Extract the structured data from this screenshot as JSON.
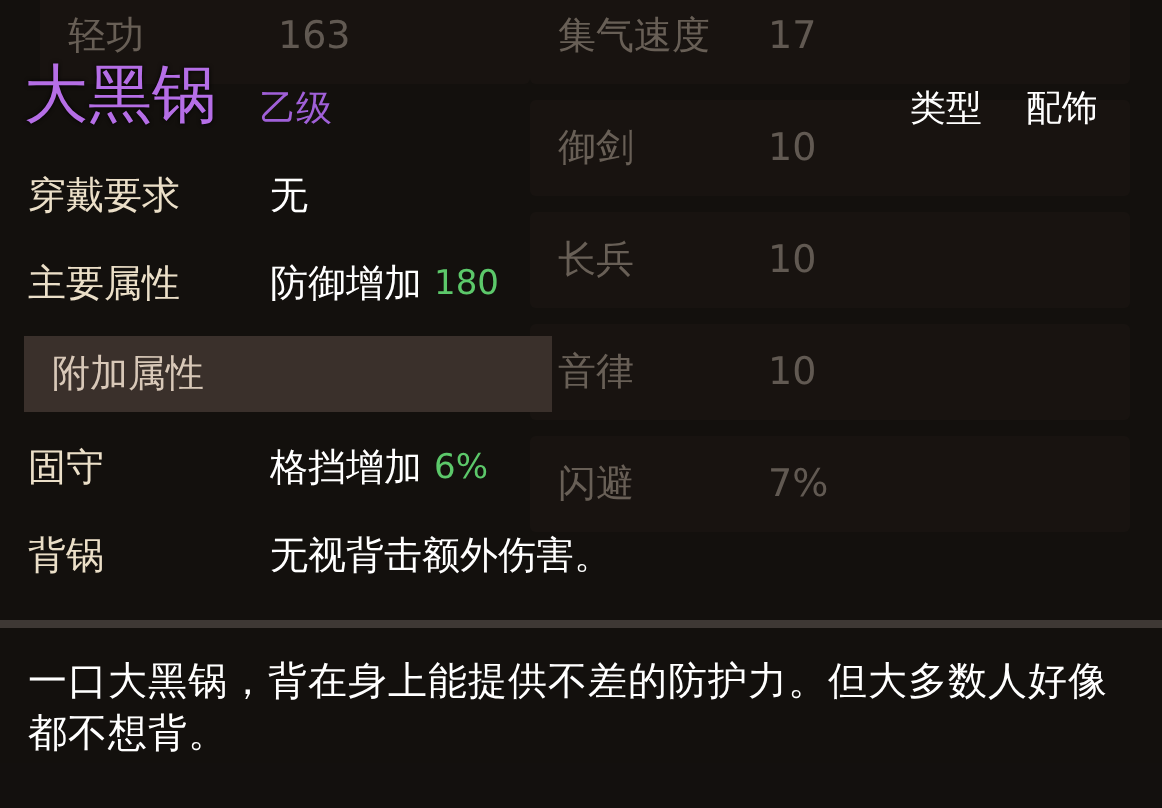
{
  "background_stats": {
    "left_column": [
      {
        "label": "轻功",
        "value": "163"
      }
    ],
    "right_column": [
      {
        "label": "集气速度",
        "value": "17"
      },
      {
        "label": "御剑",
        "value": "10"
      },
      {
        "label": "长兵",
        "value": "10"
      },
      {
        "label": "音律",
        "value": "10"
      },
      {
        "label": "闪避",
        "value": "7%"
      }
    ]
  },
  "tooltip": {
    "name": "大黑锅",
    "grade": "乙级",
    "type_label": "类型",
    "type_value": "配饰",
    "requirement": {
      "label": "穿戴要求",
      "value": "无"
    },
    "main_attribute": {
      "label": "主要属性",
      "value": "防御增加",
      "bonus": "180"
    },
    "extra_header": "附加属性",
    "extra_attributes": [
      {
        "label": "固守",
        "value": "格挡增加",
        "bonus": "6%"
      },
      {
        "label": "背锅",
        "value": "无视背击额外伤害。"
      }
    ],
    "description": "一口大黑锅，背在身上能提供不差的防护力。但大多数人好像都不想背。"
  }
}
